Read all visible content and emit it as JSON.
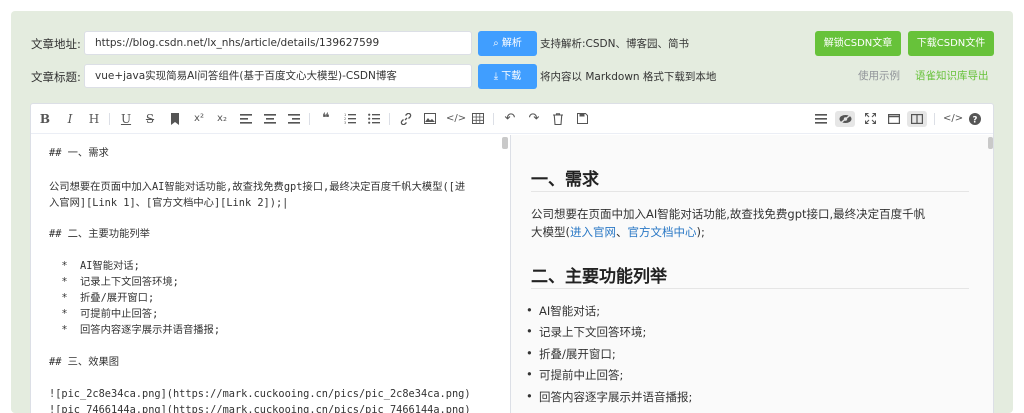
{
  "form": {
    "url_label": "文章地址:",
    "url_value": "https://blog.csdn.net/lx_nhs/article/details/139627599",
    "title_label": "文章标题:",
    "title_value": "vue+java实现简易AI问答组件(基于百度文心大模型)-CSDN博客",
    "parse_button": "⌕ 解析",
    "download_button": "⤓ 下载",
    "support_note": "支持解析:CSDN、博客园、简书",
    "download_note": "将内容以 Markdown 格式下载到本地",
    "parse_csdn_button": "解锁CSDN文章",
    "download_csdn_button": "下载CSDN文件",
    "usage_link": "使用示例",
    "export_link": "语雀知识库导出"
  },
  "toolbar": {
    "icons": [
      "bold-icon",
      "italic-icon",
      "heading-icon",
      "underline-icon",
      "strikethrough-icon",
      "bookmark-icon",
      "superscript-icon",
      "subscript-icon",
      "align-left-icon",
      "align-center-icon",
      "align-right-icon",
      "quote-icon",
      "ordered-list-icon",
      "unordered-list-icon",
      "link-icon",
      "image-icon",
      "code-icon",
      "table-icon",
      "undo-icon",
      "redo-icon",
      "trash-icon",
      "save-icon",
      "navigation-icon",
      "preview-icon",
      "fullscreen-icon",
      "read-mode-icon",
      "split-view-icon",
      "html-code-icon",
      "help-icon"
    ]
  },
  "editor": {
    "lines": {
      "l1": "## 一、需求",
      "l2": "公司想要在页面中加入AI智能对话功能,故查找免费gpt接口,最终决定百度千帆大模型([进",
      "l3": "入官网][Link 1]、[官方文档中心][Link 2]);|",
      "l4": "## 二、主要功能列举",
      "l5": "  *  AI智能对话;",
      "l6": "  *  记录上下文回答环境;",
      "l7": "  *  折叠/展开窗口;",
      "l8": "  *  可提前中止回答;",
      "l9": "  *  回答内容逐字展示并语音播报;",
      "l10": "## 三、效果图",
      "l11": "![pic_2c8e34ca.png](https://mark.cuckooing.cn/pics/pic_2c8e34ca.png)",
      "l12": "![pic_7466144a.png](https://mark.cuckooing.cn/pics/pic_7466144a.png)"
    }
  },
  "preview": {
    "h1_a": "一、需求",
    "p1_a": "公司想要在页面中加入AI智能对话功能,故查找免费gpt接口,最终决定百度千帆",
    "p1_b": "大模型(",
    "link1": "进入官网",
    "sep1": "、",
    "link2": "官方文档中心",
    "p1_c": ");",
    "h1_b": "二、主要功能列举",
    "items": [
      "AI智能对话;",
      "记录上下文回答环境;",
      "折叠/展开窗口;",
      "可提前中止回答;",
      "回答内容逐字展示并语音播报;"
    ]
  }
}
